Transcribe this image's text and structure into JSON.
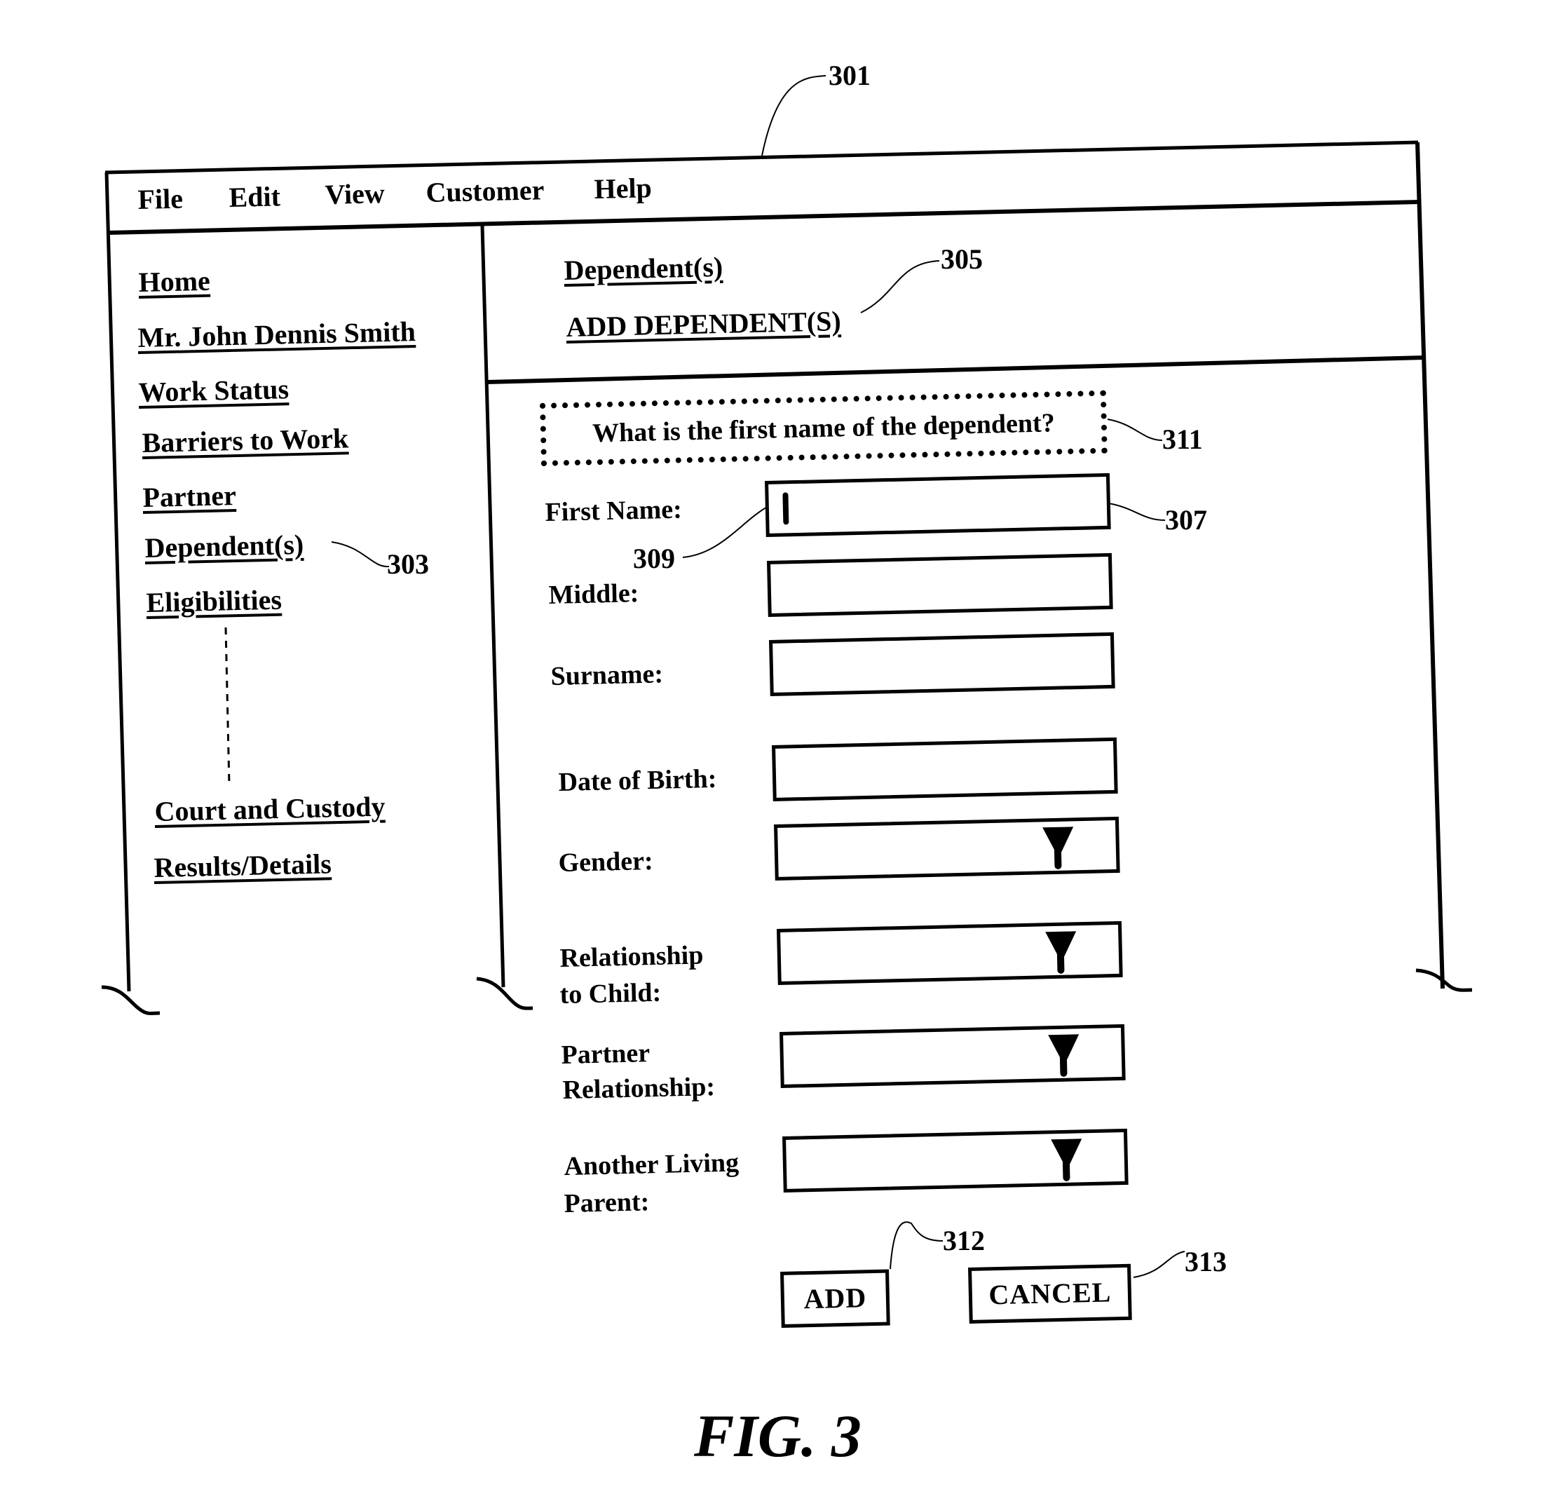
{
  "window": {
    "reference_label": "301",
    "menu": [
      "File",
      "Edit",
      "View",
      "Customer",
      "Help"
    ]
  },
  "sidebar": {
    "reference_label": "303",
    "items": [
      {
        "label": "Home"
      },
      {
        "label": "Mr. John Dennis Smith"
      },
      {
        "label": "Work Status"
      },
      {
        "label": "Barriers to Work"
      },
      {
        "label": "Partner"
      },
      {
        "label": "Dependent(s)"
      },
      {
        "label": "Eligibilities"
      },
      {
        "label": "Court and Custody"
      },
      {
        "label": "Results/Details"
      }
    ]
  },
  "header": {
    "breadcrumb": "Dependent(s)",
    "title": "ADD DEPENDENT(S)",
    "reference_label": "305"
  },
  "form": {
    "question": "What is the first name of the dependent?",
    "question_reference_label": "311",
    "first_name_field_reference_label": "307",
    "cursor_reference_label": "309",
    "fields": [
      {
        "label": "First Name:",
        "type": "text",
        "value": ""
      },
      {
        "label": "Middle:",
        "type": "text",
        "value": ""
      },
      {
        "label": "Surname:",
        "type": "text",
        "value": ""
      },
      {
        "label": "Date of Birth:",
        "type": "text",
        "value": ""
      },
      {
        "label": "Gender:",
        "type": "select",
        "value": ""
      },
      {
        "label_line1": "Relationship",
        "label_line2": "to Child:",
        "type": "select",
        "value": ""
      },
      {
        "label_line1": "Partner",
        "label_line2": "Relationship:",
        "type": "select",
        "value": ""
      },
      {
        "label_line1": "Another Living",
        "label_line2": "Parent:",
        "type": "select",
        "value": ""
      }
    ],
    "add_button": {
      "label": "ADD",
      "reference_label": "312"
    },
    "cancel_button": {
      "label": "CANCEL",
      "reference_label": "313"
    }
  },
  "figure_caption": "FIG. 3"
}
